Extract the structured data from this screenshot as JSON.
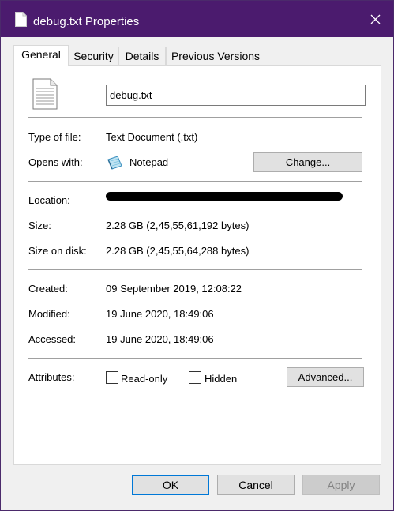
{
  "window": {
    "title": "debug.txt Properties"
  },
  "tabs": [
    {
      "label": "General"
    },
    {
      "label": "Security"
    },
    {
      "label": "Details"
    },
    {
      "label": "Previous Versions"
    }
  ],
  "general": {
    "file_name": "debug.txt",
    "type_of_file": {
      "label": "Type of file:",
      "value": "Text Document (.txt)"
    },
    "opens_with": {
      "label": "Opens with:",
      "value": "Notepad",
      "change_label": "Change..."
    },
    "location": {
      "label": "Location:"
    },
    "size": {
      "label": "Size:",
      "value": "2.28 GB (2,45,55,61,192 bytes)"
    },
    "size_on_disk": {
      "label": "Size on disk:",
      "value": "2.28 GB (2,45,55,64,288 bytes)"
    },
    "created": {
      "label": "Created:",
      "value": "09 September 2019, 12:08:22"
    },
    "modified": {
      "label": "Modified:",
      "value": "19 June 2020, 18:49:06"
    },
    "accessed": {
      "label": "Accessed:",
      "value": "19 June 2020, 18:49:06"
    },
    "attributes": {
      "label": "Attributes:",
      "read_only": "Read-only",
      "hidden": "Hidden",
      "advanced_label": "Advanced..."
    }
  },
  "footer": {
    "ok": "OK",
    "cancel": "Cancel",
    "apply": "Apply"
  },
  "icons": {
    "title": "document-icon",
    "close": "close-icon",
    "file": "text-file-icon",
    "opens_with": "notepad-icon"
  },
  "colors": {
    "titlebar": "#4b1b6e",
    "accent": "#0078d7"
  }
}
